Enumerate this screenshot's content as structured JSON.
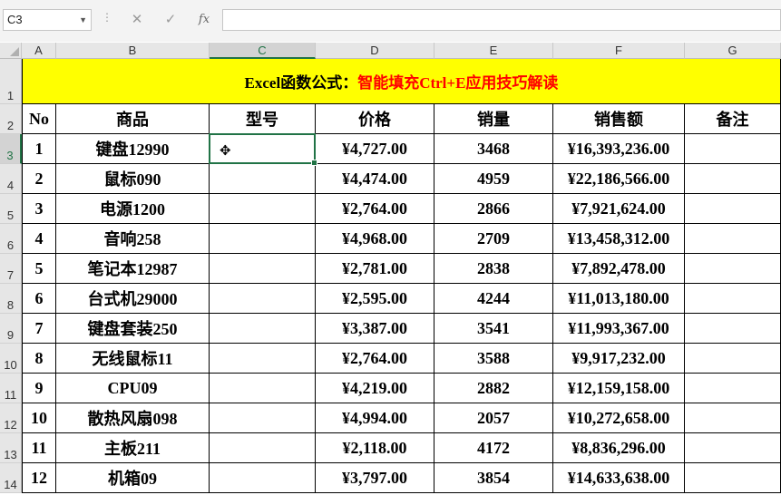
{
  "formula_bar": {
    "name_box": "C3",
    "cancel_icon": "✕",
    "enter_icon": "✓",
    "fx_label": "fx",
    "formula": ""
  },
  "columns": [
    "A",
    "B",
    "C",
    "D",
    "E",
    "F",
    "G"
  ],
  "rows": [
    "1",
    "2",
    "3",
    "4",
    "5",
    "6",
    "7",
    "8",
    "9",
    "10",
    "11",
    "12",
    "13",
    "14"
  ],
  "sheet": {
    "title_black": "Excel函数公式：",
    "title_red": "智能填充Ctrl+E应用技巧解读",
    "headers": [
      "No",
      "商品",
      "型号",
      "价格",
      "销量",
      "销售额",
      "备注"
    ],
    "records": [
      [
        "1",
        "键盘12990",
        "",
        "¥4,727.00",
        "3468",
        "¥16,393,236.00",
        ""
      ],
      [
        "2",
        "鼠标090",
        "",
        "¥4,474.00",
        "4959",
        "¥22,186,566.00",
        ""
      ],
      [
        "3",
        "电源1200",
        "",
        "¥2,764.00",
        "2866",
        "¥7,921,624.00",
        ""
      ],
      [
        "4",
        "音响258",
        "",
        "¥4,968.00",
        "2709",
        "¥13,458,312.00",
        ""
      ],
      [
        "5",
        "笔记本12987",
        "",
        "¥2,781.00",
        "2838",
        "¥7,892,478.00",
        ""
      ],
      [
        "6",
        "台式机29000",
        "",
        "¥2,595.00",
        "4244",
        "¥11,013,180.00",
        ""
      ],
      [
        "7",
        "键盘套装250",
        "",
        "¥3,387.00",
        "3541",
        "¥11,993,367.00",
        ""
      ],
      [
        "8",
        "无线鼠标11",
        "",
        "¥2,764.00",
        "3588",
        "¥9,917,232.00",
        ""
      ],
      [
        "9",
        "CPU09",
        "",
        "¥4,219.00",
        "2882",
        "¥12,159,158.00",
        ""
      ],
      [
        "10",
        "散热风扇098",
        "",
        "¥4,994.00",
        "2057",
        "¥10,272,658.00",
        ""
      ],
      [
        "11",
        "主板211",
        "",
        "¥2,118.00",
        "4172",
        "¥8,836,296.00",
        ""
      ],
      [
        "12",
        "机箱09",
        "",
        "¥3,797.00",
        "3854",
        "¥14,633,638.00",
        ""
      ]
    ]
  },
  "colors": {
    "title_fill": "#ffff00",
    "title_red": "#ff0000",
    "selection": "#217346"
  },
  "icons": {
    "cursor": "cell-select-cursor-icon"
  }
}
